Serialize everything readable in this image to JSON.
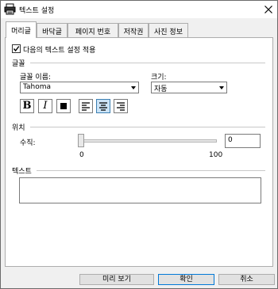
{
  "window": {
    "title": "텍스트 설정",
    "icons": {
      "app": "printer-icon",
      "close": "close-icon"
    }
  },
  "tabs": [
    {
      "label": "머리글",
      "active": true
    },
    {
      "label": "바닥글",
      "active": false
    },
    {
      "label": "페이지 번호",
      "active": false
    },
    {
      "label": "저작권",
      "active": false
    },
    {
      "label": "사진 정보",
      "active": false
    }
  ],
  "apply_checkbox": {
    "label": "다음의 텍스트 설정 적용",
    "checked": true
  },
  "font_group": {
    "title": "글꼴",
    "font_name_label": "글꼴 이름:",
    "font_name_value": "Tahoma",
    "size_label": "크기:",
    "size_value": "자동",
    "format_buttons": [
      {
        "name": "bold",
        "glyph": "B",
        "pressed": false
      },
      {
        "name": "italic",
        "glyph": "I",
        "pressed": false
      },
      {
        "name": "color",
        "glyph": "",
        "pressed": false
      },
      {
        "name": "align-left",
        "icon": "align-left-icon",
        "pressed": false
      },
      {
        "name": "align-center",
        "icon": "align-center-icon",
        "pressed": true
      },
      {
        "name": "align-right",
        "icon": "align-right-icon",
        "pressed": false
      }
    ]
  },
  "position_group": {
    "title": "위치",
    "vertical_label": "수직:",
    "vertical_value": "0",
    "slider_min": "0",
    "slider_max": "100",
    "slider_level": 0
  },
  "text_group": {
    "title": "텍스트",
    "value": ""
  },
  "buttons": {
    "preview": "미리 보기",
    "ok": "확인",
    "cancel": "취소"
  },
  "colors": {
    "accent": "#0078d7",
    "pressed_bg": "#cce4f7"
  }
}
